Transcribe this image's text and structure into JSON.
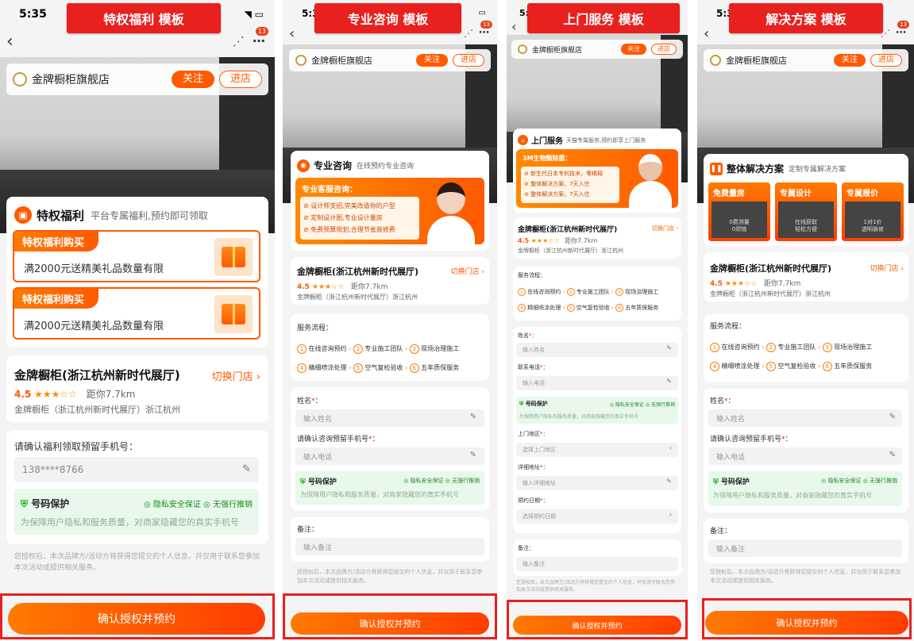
{
  "panels": [
    {
      "banner": "特权福利 模板",
      "time": "5:35",
      "badge": "13",
      "store": {
        "name": "金牌橱柜旗舰店",
        "follow": "关注",
        "enter": "进店"
      },
      "card_title": "特权福利",
      "card_sub": "平台专属福利,预约即可领取",
      "promos": [
        {
          "tag": "特权福利购买",
          "text": "满2000元送精美礼品数量有限"
        },
        {
          "tag": "特权福利购买",
          "text": "满2000元送精美礼品数量有限"
        }
      ],
      "shop": {
        "name": "金牌橱柜(浙江杭州新时代展厅)",
        "switch": "切换门店",
        "rating": "4.5",
        "stars": "★★★☆☆",
        "distance": "距你7.7km",
        "address": "金牌橱柜（浙江杭州新时代展厅）浙江杭州"
      },
      "phone_label": "请确认福利领取预留手机号：",
      "phone_value": "138****8766",
      "protect": {
        "title": "号码保护",
        "tag1": "隐私安全保证",
        "tag2": "无强行推销",
        "desc": "为保障用户隐私和服务质量，对商家隐藏您的真实手机号"
      },
      "disclaimer": "您授权后，本次品牌方/活动方将获得您提交的个人信息，并仅用于联系您参加本次活动或提供相关服务。",
      "cta": "确认授权并预约"
    },
    {
      "banner": "专业咨询 模板",
      "time": "5:3",
      "badge": "13",
      "store": {
        "name": "金牌橱柜旗舰店",
        "follow": "关注",
        "enter": "进店"
      },
      "card_title": "专业咨询",
      "card_sub": "在线预约专业咨询",
      "consult_head": "专业客服咨询：",
      "consult_items": [
        "设计师支招,完美改造你的户型",
        "定制设计图,专业设计量房",
        "免费预算规划,合理节省装修费"
      ],
      "shop": {
        "name": "金牌橱柜(浙江杭州新时代展厅)",
        "switch": "切换门店",
        "rating": "4.5",
        "stars": "★★★☆☆",
        "distance": "距你7.7km",
        "address": "金牌橱柜（浙江杭州新时代展厅）浙江杭州"
      },
      "flow_label": "服务流程：",
      "steps": [
        "在线咨询预约",
        "专业施工团队",
        "现场治理施工",
        "精细喷涂处理",
        "空气复检验收",
        "五年质保服务"
      ],
      "name_label": "姓名",
      "name_ph": "输入姓名",
      "phone_label": "请确认咨询预留手机号",
      "phone_ph": "输入电话",
      "protect": {
        "title": "号码保护",
        "tag1": "隐私安全保证",
        "tag2": "无强行推销",
        "desc": "为保障用户隐私和服务质量，对商家隐藏您的真实手机号"
      },
      "remark_label": "备注：",
      "remark_ph": "输入备注",
      "disclaimer": "您授权后，本次品牌方/活动方将获得您提交的个人信息，并仅用于联系您参加本次活动或提供相关服务。",
      "cta": "确认授权并预约"
    },
    {
      "banner": "上门服务 模板",
      "time": "5:",
      "badge": "13",
      "store": {
        "name": "金牌橱柜旗舰店",
        "follow": "关注",
        "enter": "进店"
      },
      "card_title": "上门服务",
      "card_sub": "天猫专属服务,预约即享上门服务",
      "consult_head": "3M生物酶除菌：",
      "consult_items": [
        "新生代日本专利技术，零稀释",
        "整体解决方案，7天入住",
        "整体解决方案，7天入住"
      ],
      "shop": {
        "name": "金牌橱柜(浙江杭州新时代展厅)",
        "switch": "切换门店",
        "rating": "4.5",
        "stars": "★★★☆☆",
        "distance": "距你7.7km",
        "address": "金牌橱柜（浙江杭州新时代展厅）浙江杭州"
      },
      "flow_label": "服务流程：",
      "steps": [
        "在线咨询预约",
        "专业施工团队",
        "现场治理施工",
        "精细喷涂处理",
        "空气复检验收",
        "五年质保服务"
      ],
      "name_label": "姓名",
      "name_ph": "输入姓名",
      "phone_label": "联系电话",
      "phone_ph": "输入电话",
      "protect": {
        "title": "号码保护",
        "tag1": "隐私安全保证",
        "tag2": "无强行推销",
        "desc": "为保障用户隐私和服务质量，对商家隐藏您的真实手机号"
      },
      "area_label": "上门地区",
      "area_ph": "选择上门地区",
      "addr_label": "详细地址",
      "addr_ph": "输入详细地址",
      "date_label": "预约日期",
      "date_ph": "选择预约日期",
      "remark_label": "备注：",
      "remark_ph": "输入备注",
      "disclaimer": "您授权后，本次品牌方/活动方将获得您提交的个人信息，并仅用于联系您参加本次活动或提供相关服务。",
      "cta": "确认授权并预约"
    },
    {
      "banner": "解决方案 模板",
      "time": "5:3",
      "badge": "13",
      "store": {
        "name": "金牌橱柜旗舰店",
        "follow": "关注",
        "enter": "进店"
      },
      "card_title": "整体解决方案",
      "card_sub": "定制专属解决方案",
      "features": [
        {
          "title": "免费量房",
          "l1": "0费测量",
          "l2": "0烦恼"
        },
        {
          "title": "专属设计",
          "l1": "在线获取",
          "l2": "轻松方便"
        },
        {
          "title": "专属报价",
          "l1": "1对1价",
          "l2": "透明装修"
        }
      ],
      "shop": {
        "name": "金牌橱柜(浙江杭州新时代展厅)",
        "switch": "切换门店",
        "rating": "4.5",
        "stars": "★★★☆☆",
        "distance": "距你7.7km",
        "address": "金牌橱柜（浙江杭州新时代展厅）浙江杭州"
      },
      "flow_label": "服务流程：",
      "steps": [
        "在线咨询预约",
        "专业施工团队",
        "现场治理施工",
        "精细喷涂处理",
        "空气复检验收",
        "五年质保服务"
      ],
      "name_label": "姓名",
      "name_ph": "输入姓名",
      "phone_label": "请确认咨询预留手机号",
      "phone_ph": "输入电话",
      "protect": {
        "title": "号码保护",
        "tag1": "隐私安全保证",
        "tag2": "无强行推销",
        "desc": "为保障用户隐私和服务质量，对商家隐藏您的真实手机号"
      },
      "remark_label": "备注：",
      "remark_ph": "输入备注",
      "disclaimer": "您授权后，本次品牌方/活动方将获得您提交的个人信息，并仅用于联系您参加本次活动或提供相关服务。",
      "cta": "确认授权并预约"
    }
  ]
}
